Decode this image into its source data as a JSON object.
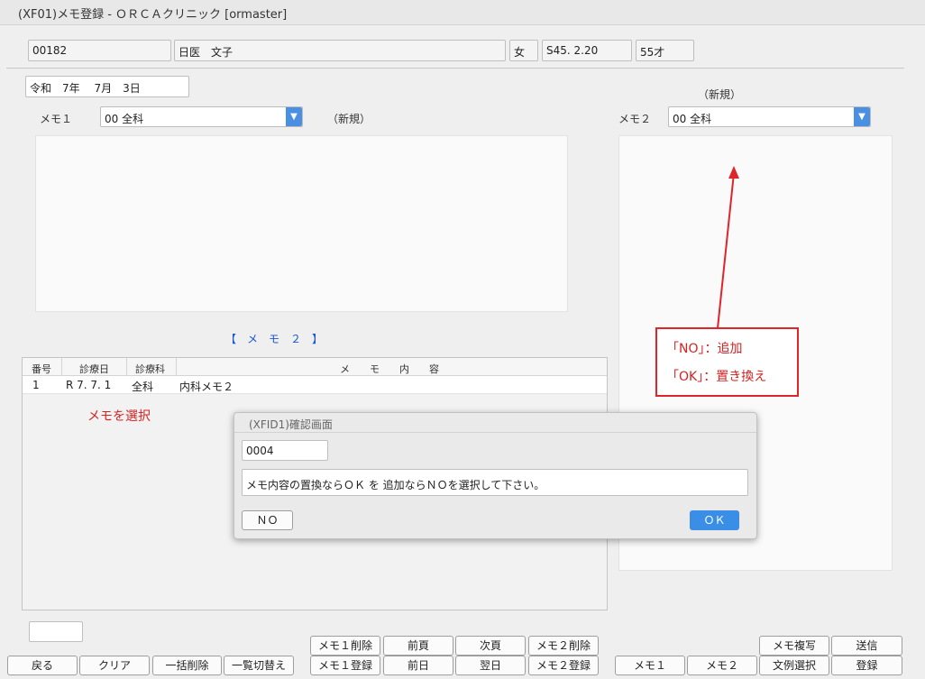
{
  "window": {
    "title": "(XF01)メモ登録 - ＯＲＣＡクリニック [ormaster]"
  },
  "patient": {
    "id": "00182",
    "name": "日医　文子",
    "sex": "女",
    "birth": "S45. 2.20",
    "age": "55才"
  },
  "date": "令和　7年　 7月　3日",
  "memo1": {
    "label": "メモ１",
    "dept": "00 全科",
    "status": "（新規）"
  },
  "memo2": {
    "label": "メモ２",
    "dept": "00 全科",
    "status": "（新規）"
  },
  "list": {
    "title": "【　メ　モ　２　】",
    "headers": {
      "no": "番号",
      "date": "診療日",
      "dept": "診療科",
      "content": "メ　　モ　　内　　容"
    },
    "rows": [
      {
        "no": "1",
        "date": "R 7. 7. 1",
        "dept": "全科",
        "content": "内科メモ２"
      }
    ]
  },
  "annotations": {
    "select_note": "メモを選択",
    "callout_line1": "「NO」：追加",
    "callout_line2": "「OK」：置き換え"
  },
  "dialog": {
    "title": "(XFID1)確認画面",
    "code": "0004",
    "message": "メモ内容の置換ならＯＫ を 追加ならＮＯを選択して下さい。",
    "no_label": "ＮＯ",
    "ok_label": "ＯＫ"
  },
  "footer": {
    "input_value": "",
    "back": "戻る",
    "clear": "クリア",
    "bulk_delete": "一括削除",
    "list_toggle": "一覧切替え",
    "memo1_delete": "メモ１削除",
    "memo1_register": "メモ１登録",
    "prev_page": "前頁",
    "prev_day": "前日",
    "next_page": "次頁",
    "next_day": "翌日",
    "memo2_delete": "メモ２削除",
    "memo2_register": "メモ２登録",
    "memo1": "メモ１",
    "memo2": "メモ２",
    "memo_copy": "メモ複写",
    "sample_select": "文例選択",
    "send": "送信",
    "register": "登録"
  },
  "colors": {
    "accent": "#4a90e2",
    "annotation_red": "#e0242b",
    "list_title_blue": "#1a56d6"
  }
}
